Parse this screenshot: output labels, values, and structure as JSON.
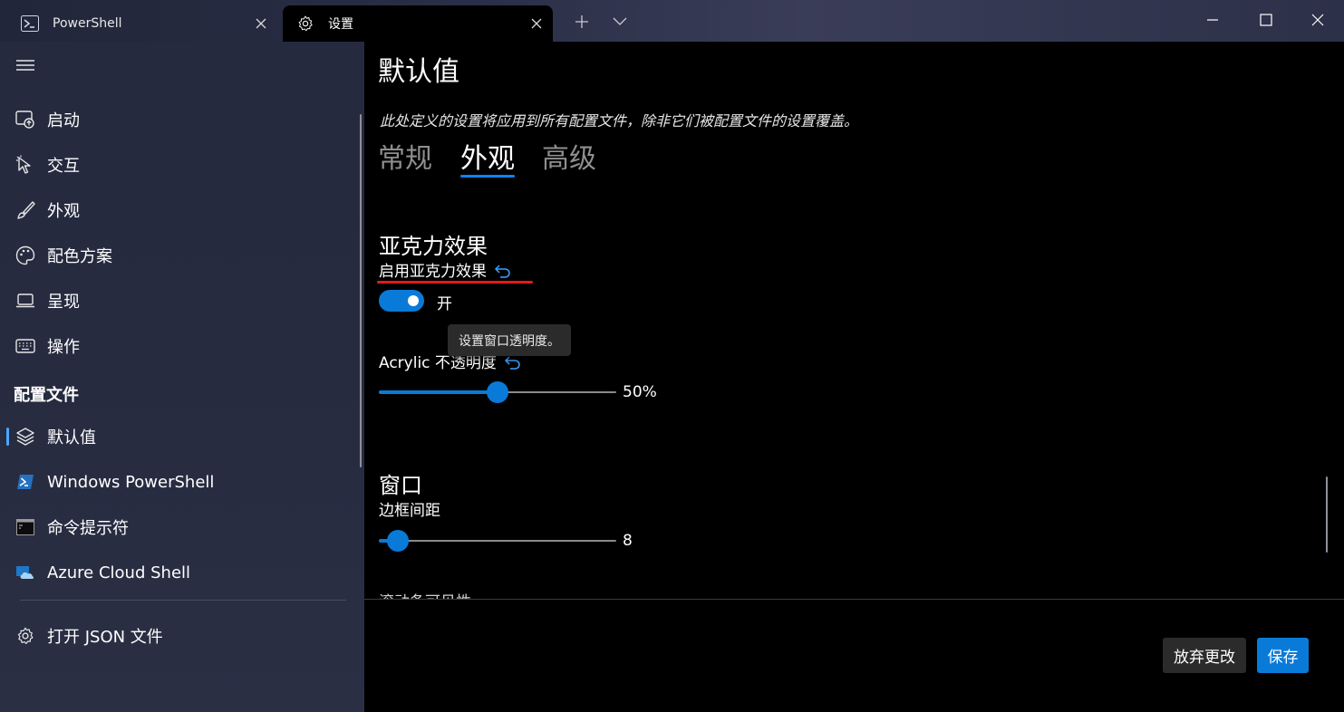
{
  "titlebar": {
    "tabs": [
      {
        "label": "PowerShell",
        "icon": "powershell-icon"
      },
      {
        "label": "设置",
        "icon": "gear-icon"
      }
    ]
  },
  "sidebar": {
    "items": [
      {
        "label": "启动",
        "icon": "startup-icon"
      },
      {
        "label": "交互",
        "icon": "interaction-icon"
      },
      {
        "label": "外观",
        "icon": "brush-icon"
      },
      {
        "label": "配色方案",
        "icon": "palette-icon"
      },
      {
        "label": "呈现",
        "icon": "laptop-icon"
      },
      {
        "label": "操作",
        "icon": "keyboard-icon"
      }
    ],
    "profiles_header": "配置文件",
    "profiles": [
      {
        "label": "默认值",
        "icon": "layers-icon",
        "active": true
      },
      {
        "label": "Windows PowerShell",
        "icon": "powershell-icon"
      },
      {
        "label": "命令提示符",
        "icon": "cmd-icon"
      },
      {
        "label": "Azure Cloud Shell",
        "icon": "azure-icon"
      }
    ],
    "open_json": "打开 JSON 文件"
  },
  "main": {
    "title": "默认值",
    "description": "此处定义的设置将应用到所有配置文件，除非它们被配置文件的设置覆盖。",
    "tabs": [
      "常规",
      "外观",
      "高级"
    ],
    "selected_tab": "外观",
    "acrylic": {
      "section": "亚克力效果",
      "enable_label": "启用亚克力效果",
      "toggle_state": "开",
      "toggle_on": true,
      "tooltip": "设置窗口透明度。",
      "opacity_label": "Acrylic 不透明度",
      "opacity_value": 50,
      "opacity_text": "50%"
    },
    "window": {
      "section": "窗口",
      "padding_label": "边框间距",
      "padding_value": 8,
      "padding_max": 100,
      "padding_text": "8",
      "next_label": "滚动条可见性"
    }
  },
  "footer": {
    "discard": "放弃更改",
    "save": "保存"
  },
  "colors": {
    "accent": "#0a7ad8",
    "annotation_red": "#e21b1b"
  }
}
